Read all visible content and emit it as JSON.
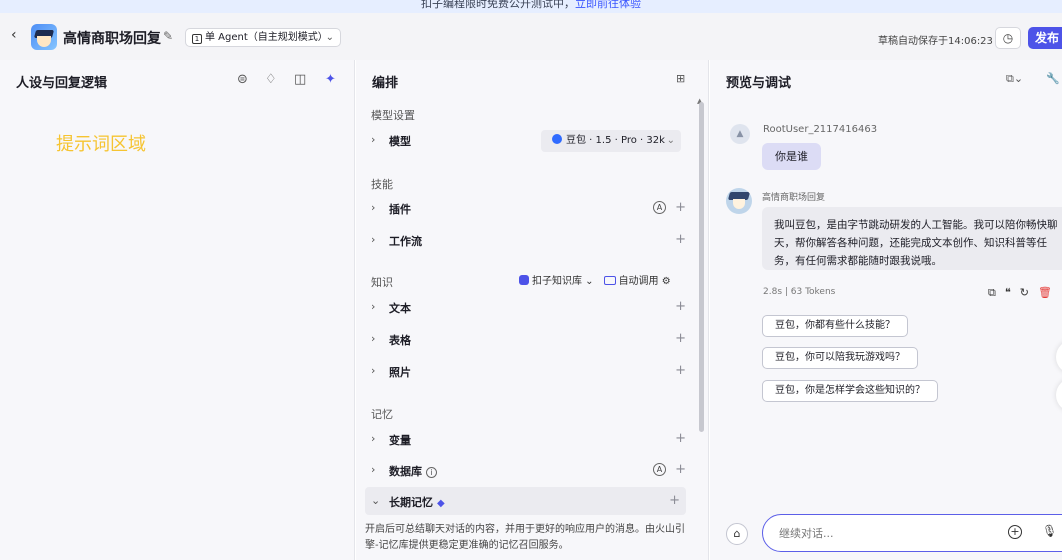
{
  "banner": {
    "text": "扣子编程限时免费公开测试中，",
    "link": "立即前往体验"
  },
  "header": {
    "back_glyph": "‹",
    "app_title": "高情商职场回复",
    "mode_label": "单 Agent（自主规划模式）",
    "autosave": "草稿自动保存于14:06:23",
    "publish_label": "发布"
  },
  "left_panel": {
    "title": "人设与回复逻辑",
    "prompt_hint": "提示词区域"
  },
  "middle_panel": {
    "title": "编排",
    "model_section": "模型设置",
    "model_row": "模型",
    "model_value": "豆包 · 1.5 · Pro · 32k",
    "skills_section": "技能",
    "plugins_row": "插件",
    "workflow_row": "工作流",
    "knowledge_section": "知识",
    "kb_source": "扣子知识库",
    "kb_call_mode": "自动调用",
    "text_row": "文本",
    "table_row": "表格",
    "photo_row": "照片",
    "memory_section": "记忆",
    "variable_row": "变量",
    "database_row": "数据库",
    "long_term_memory": "长期记忆",
    "long_term_desc": "开启后可总结聊天对话的内容，并用于更好的响应用户的消息。由火山引擎-记忆库提供更稳定更准确的记忆召回服务。",
    "auto_badge": "A",
    "plus": "+"
  },
  "right_panel": {
    "title": "预览与调试",
    "user_name": "RootUser_2117416463",
    "user_message": "你是谁",
    "bot_name": "高情商职场回复",
    "bot_message": "我叫豆包，是由字节跳动研发的人工智能。我可以陪你畅快聊天，帮你解答各种问题，还能完成文本创作、知识科普等任务，有任何需求都能随时跟我说哦。",
    "meta": "2.8s | 63 Tokens",
    "suggestions": [
      "豆包，你都有些什么技能？",
      "豆包，你可以陪我玩游戏吗？",
      "豆包，你是怎样学会这些知识的？"
    ],
    "input_placeholder": "继续对话..."
  },
  "icons": {
    "edit": "edit-icon",
    "history": "history-icon",
    "copy": "copy-icon",
    "quote": "quote-icon",
    "refresh": "refresh-icon",
    "delete": "delete-icon",
    "microphone": "microphone-icon"
  },
  "colors": {
    "accent": "#4d53e8",
    "prompt_hint": "#f6c431",
    "user_bubble": "#dcdcf5",
    "delete": "#e53935"
  }
}
